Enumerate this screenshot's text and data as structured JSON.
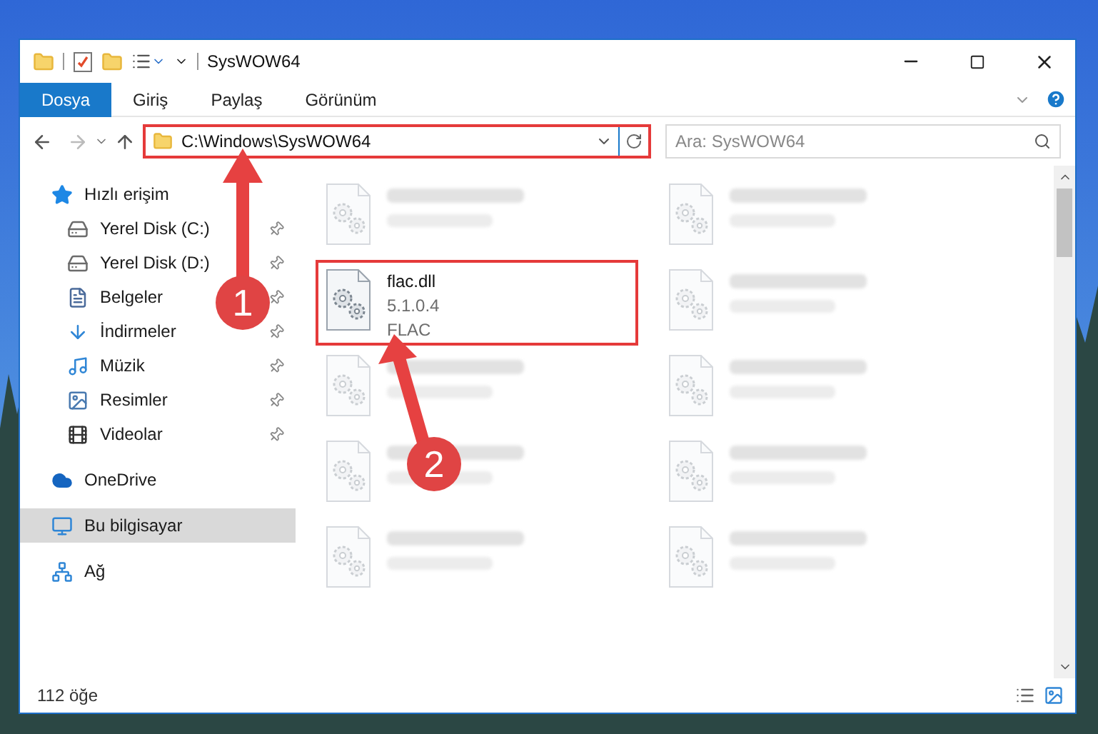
{
  "window": {
    "title": "SysWOW64"
  },
  "ribbon_tabs": [
    {
      "label": "Dosya",
      "selected": true
    },
    {
      "label": "Giriş",
      "selected": false
    },
    {
      "label": "Paylaş",
      "selected": false
    },
    {
      "label": "Görünüm",
      "selected": false
    }
  ],
  "address_bar": {
    "path": "C:\\Windows\\SysWOW64",
    "highlighted": true
  },
  "search": {
    "placeholder": "Ara: SysWOW64"
  },
  "sidebar": {
    "items": [
      {
        "label": "Hızlı erişim",
        "kind": "quick-access",
        "selected": false,
        "children": [
          {
            "label": "Yerel Disk (C:)",
            "kind": "system-drive",
            "pinned": true,
            "selected": false
          },
          {
            "label": "Yerel Disk (D:)",
            "kind": "drive",
            "pinned": true,
            "selected": false
          },
          {
            "label": "Belgeler",
            "kind": "documents",
            "pinned": true,
            "selected": false
          },
          {
            "label": "İndirmeler",
            "kind": "downloads",
            "pinned": true,
            "selected": false
          },
          {
            "label": "Müzik",
            "kind": "music",
            "pinned": true,
            "selected": false
          },
          {
            "label": "Resimler",
            "kind": "pictures",
            "pinned": true,
            "selected": false
          },
          {
            "label": "Videolar",
            "kind": "videos",
            "pinned": true,
            "selected": false
          }
        ]
      },
      {
        "label": "OneDrive",
        "kind": "cloud",
        "selected": false
      },
      {
        "label": "Bu bilgisayar",
        "kind": "computer",
        "selected": true
      },
      {
        "label": "Ağ",
        "kind": "network",
        "selected": false
      }
    ]
  },
  "files": [
    {
      "kind": "blurred"
    },
    {
      "kind": "blurred"
    },
    {
      "kind": "file",
      "name": "flac.dll",
      "details": [
        "5.1.0.4",
        "FLAC"
      ],
      "highlighted": true
    },
    {
      "kind": "blurred"
    },
    {
      "kind": "blurred"
    },
    {
      "kind": "blurred"
    },
    {
      "kind": "blurred"
    },
    {
      "kind": "blurred"
    },
    {
      "kind": "blurred"
    },
    {
      "kind": "blurred"
    }
  ],
  "annotations": [
    {
      "number": "1"
    },
    {
      "number": "2"
    }
  ],
  "status_bar": {
    "count": "112 öğe"
  }
}
